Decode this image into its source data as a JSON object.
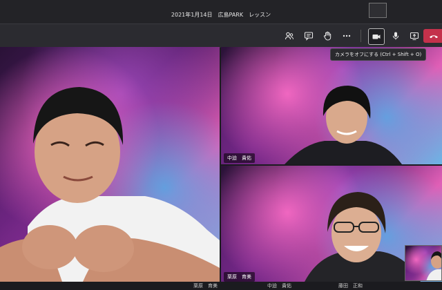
{
  "window": {
    "title": "2021年1月14日　広島PARK　レッスン"
  },
  "toolbar": {
    "buttons": [
      "participants-icon",
      "chat-icon",
      "raise-hand-icon",
      "more-icon",
      "camera-icon",
      "microphone-icon",
      "share-screen-icon",
      "leave-icon"
    ],
    "tooltip": "カメラをオフにする (Ctrl + Shift + O)"
  },
  "participants": {
    "top_right": {
      "name": "中迫　貴佑"
    },
    "bottom_right": {
      "name": "栗原　育美"
    }
  },
  "bottom_strip": [
    "栗原　育美",
    "中迫　貴佑",
    "藤田　正和"
  ],
  "colors": {
    "leave": "#c4314b",
    "background": "#1b1b1f",
    "toolbar": "#2b2b30"
  }
}
